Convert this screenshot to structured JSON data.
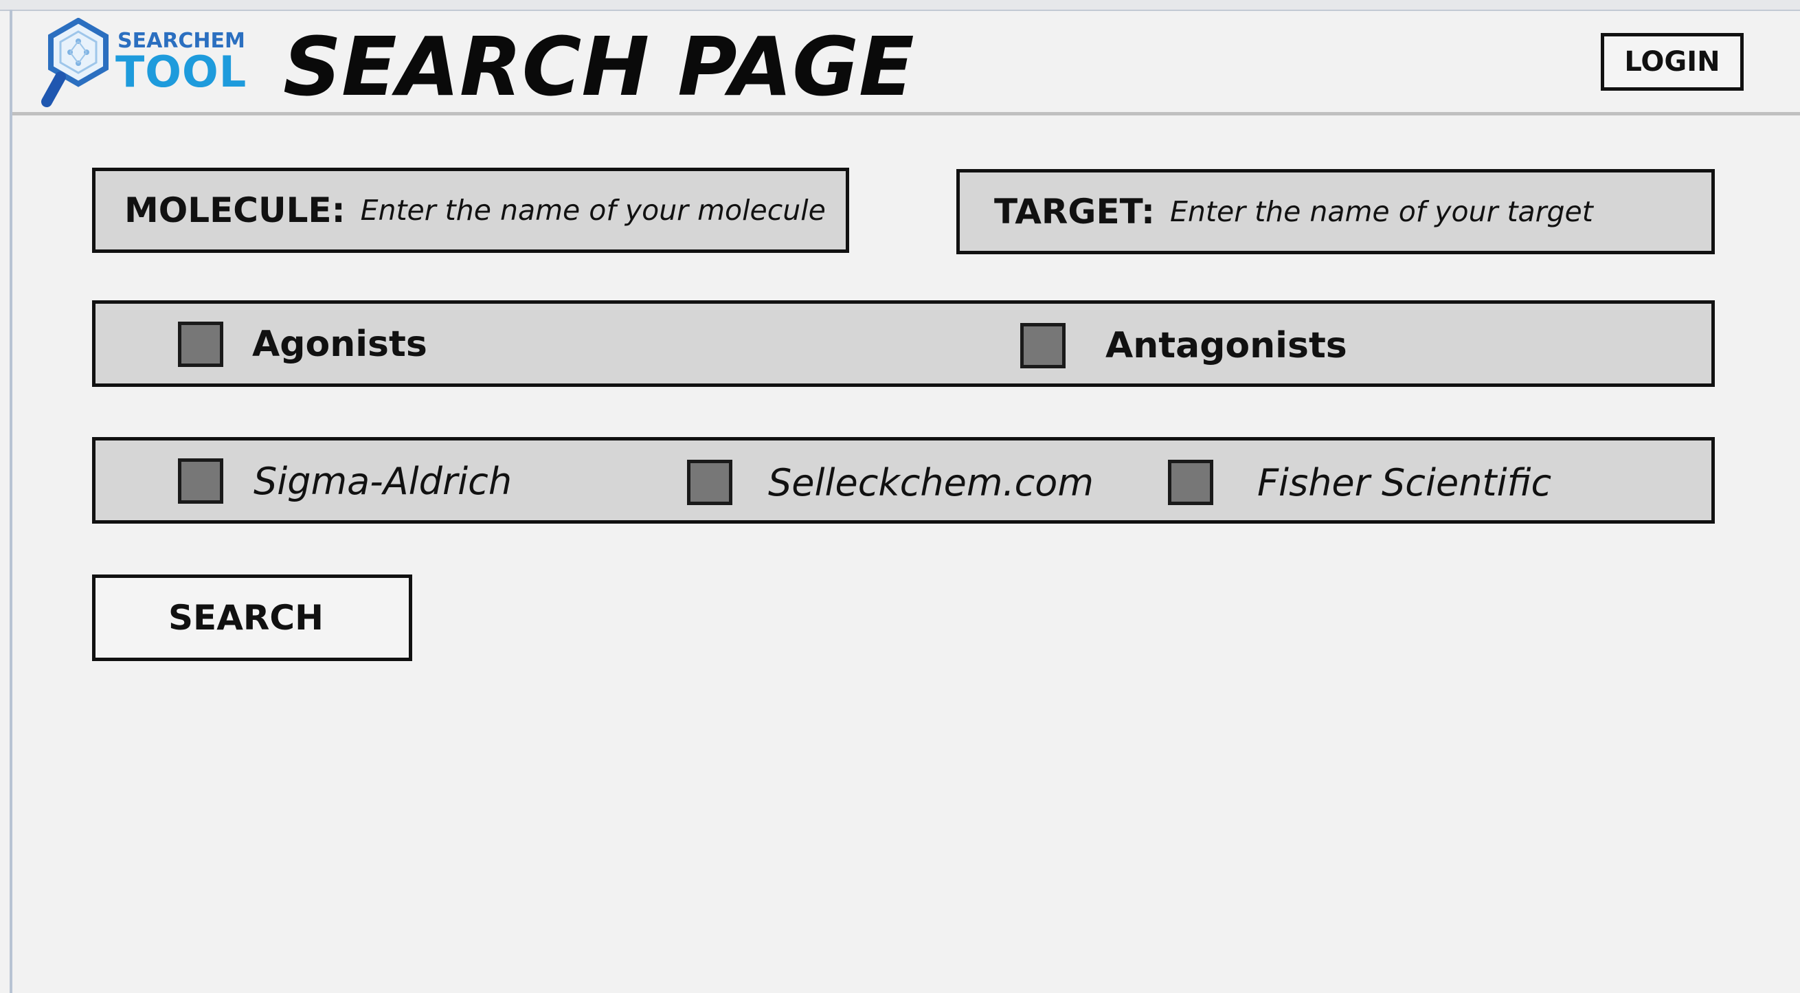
{
  "logo": {
    "line1": "SEARCHEM",
    "line2": "TOOL",
    "icon": "hexagon-magnifier-icon",
    "colors": {
      "small": "#2b6fc0",
      "big": "#1e9bdc",
      "handle": "#1f57b0"
    }
  },
  "header": {
    "title": "SEARCH PAGE",
    "login_label": "LOGIN"
  },
  "molecule": {
    "label": "MOLECULE:",
    "placeholder": "Enter the name of your molecule"
  },
  "target": {
    "label": "TARGET:",
    "placeholder": "Enter the name of your target"
  },
  "activity_options": [
    {
      "label": "Agonists",
      "checked": false
    },
    {
      "label": "Antagonists",
      "checked": false
    }
  ],
  "vendor_options": [
    {
      "label": "Sigma-Aldrich",
      "checked": false
    },
    {
      "label": "Selleckchem.com",
      "checked": false
    },
    {
      "label": "Fisher Scientific",
      "checked": false
    }
  ],
  "search_label": "SEARCH",
  "colors": {
    "background": "#f2f2f2",
    "panel": "#d6d6d6",
    "checkbox": "#777777",
    "border": "#111111"
  }
}
